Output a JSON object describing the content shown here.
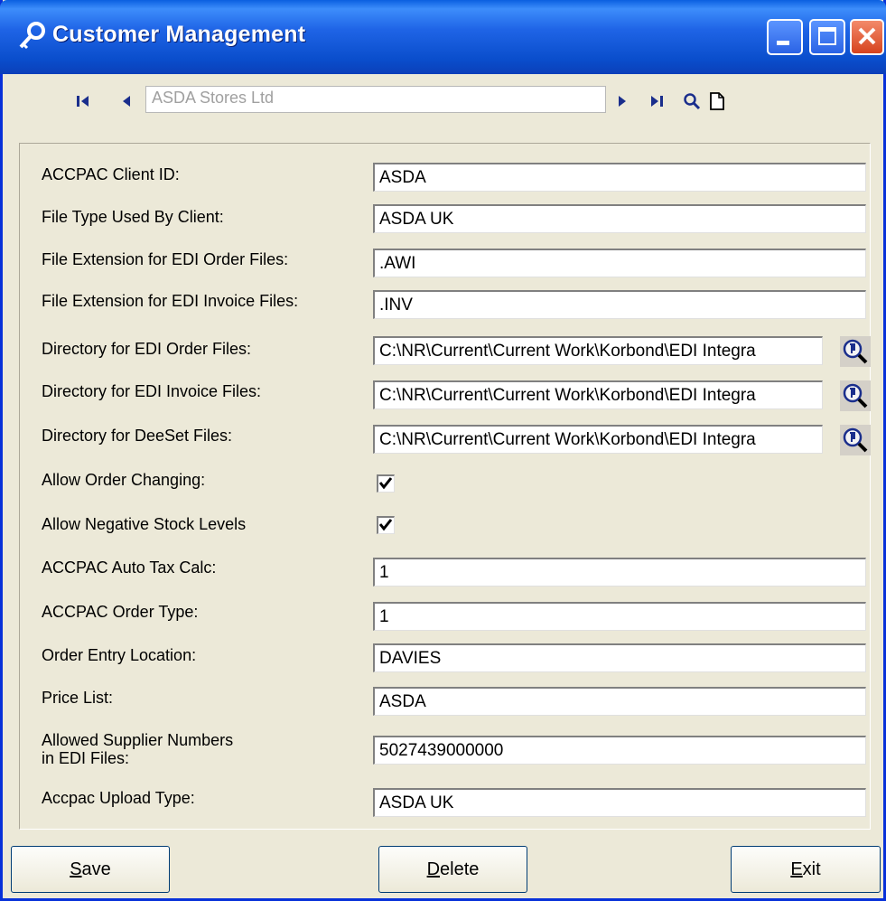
{
  "window": {
    "title": "Customer Management"
  },
  "nav": {
    "record_name": "ASDA Stores Ltd",
    "icons": [
      "first-record-icon",
      "previous-record-icon",
      "next-record-icon",
      "last-record-icon",
      "search-icon",
      "new-record-icon"
    ]
  },
  "form": {
    "client_id": {
      "label": "ACCPAC Client ID:",
      "value": "ASDA"
    },
    "file_type": {
      "label": "File Type Used By Client:",
      "value": "ASDA UK"
    },
    "order_ext": {
      "label": "File Extension for EDI Order Files:",
      "value": ".AWI"
    },
    "invoice_ext": {
      "label": "File Extension for EDI Invoice Files:",
      "value": ".INV"
    },
    "order_dir": {
      "label": "Directory for EDI Order Files:",
      "value": "C:\\NR\\Current\\Current Work\\Korbond\\EDI Integra"
    },
    "invoice_dir": {
      "label": "Directory for EDI Invoice Files:",
      "value": "C:\\NR\\Current\\Current Work\\Korbond\\EDI Integra"
    },
    "deeset_dir": {
      "label": "Directory for DeeSet Files:",
      "value": "C:\\NR\\Current\\Current Work\\Korbond\\EDI Integra"
    },
    "allow_order_changing": {
      "label": "Allow Order Changing:",
      "checked": true
    },
    "allow_negative_stock": {
      "label": "Allow Negative Stock Levels",
      "checked": true
    },
    "auto_tax_calc": {
      "label": "ACCPAC Auto Tax Calc:",
      "value": "1"
    },
    "order_type": {
      "label": "ACCPAC Order Type:",
      "value": "1"
    },
    "order_location": {
      "label": "Order Entry Location:",
      "value": "DAVIES"
    },
    "price_list": {
      "label": "Price List:",
      "value": "ASDA"
    },
    "supplier_numbers": {
      "label_line1": "Allowed Supplier Numbers",
      "label_line2": "in EDI Files:",
      "value": "5027439000000"
    },
    "upload_type": {
      "label": "Accpac Upload Type:",
      "value": "ASDA UK"
    }
  },
  "buttons": {
    "save": {
      "mnemonic": "S",
      "rest": "ave"
    },
    "delete": {
      "mnemonic": "D",
      "rest": "elete"
    },
    "exit": {
      "mnemonic": "E",
      "rest": "xit"
    }
  }
}
